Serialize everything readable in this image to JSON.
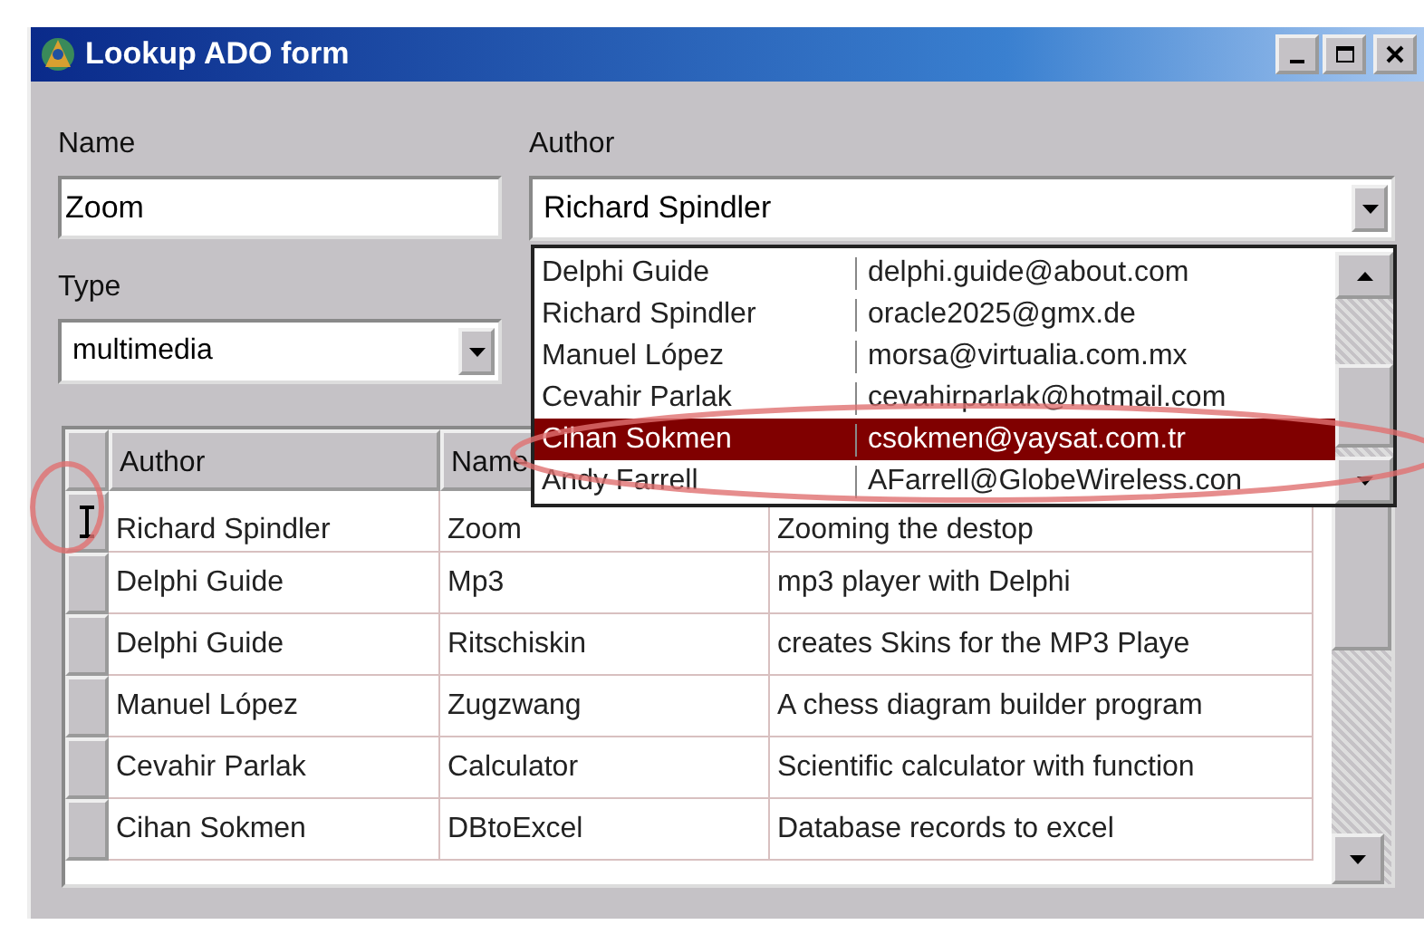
{
  "window": {
    "title": "Lookup ADO form"
  },
  "name_field": {
    "label": "Name",
    "value": "Zoom"
  },
  "author_field": {
    "label": "Author",
    "value": "Richard Spindler"
  },
  "type_field": {
    "label": "Type",
    "value": "multimedia"
  },
  "author_dropdown": {
    "rows": [
      {
        "name": "Delphi Guide",
        "email": "delphi.guide@about.com",
        "selected": false
      },
      {
        "name": "Richard Spindler",
        "email": "oracle2025@gmx.de",
        "selected": false
      },
      {
        "name": "Manuel López",
        "email": "morsa@virtualia.com.mx",
        "selected": false
      },
      {
        "name": "Cevahir Parlak",
        "email": "cevahirparlak@hotmail.com",
        "selected": false
      },
      {
        "name": "Cihan Sokmen",
        "email": "csokmen@yaysat.com.tr",
        "selected": true
      },
      {
        "name": "Andy Farrell",
        "email": "AFarrell@GlobeWireless.con",
        "selected": false
      }
    ]
  },
  "grid": {
    "columns": [
      "Author",
      "Name"
    ],
    "rows": [
      {
        "author": "Richard Spindler",
        "name": "Zoom",
        "description": "Zooming the destop",
        "current": true
      },
      {
        "author": "Delphi Guide",
        "name": "Mp3",
        "description": "mp3 player with Delphi",
        "current": false
      },
      {
        "author": "Delphi Guide",
        "name": "Ritschiskin",
        "description": "creates Skins for the MP3 Playe",
        "current": false
      },
      {
        "author": "Manuel López",
        "name": "Zugzwang",
        "description": "A chess diagram builder program",
        "current": false
      },
      {
        "author": "Cevahir Parlak",
        "name": "Calculator",
        "description": "Scientific calculator with function",
        "current": false
      },
      {
        "author": "Cihan Sokmen",
        "name": "DBtoExcel",
        "description": "Database records to excel",
        "current": false
      }
    ]
  }
}
